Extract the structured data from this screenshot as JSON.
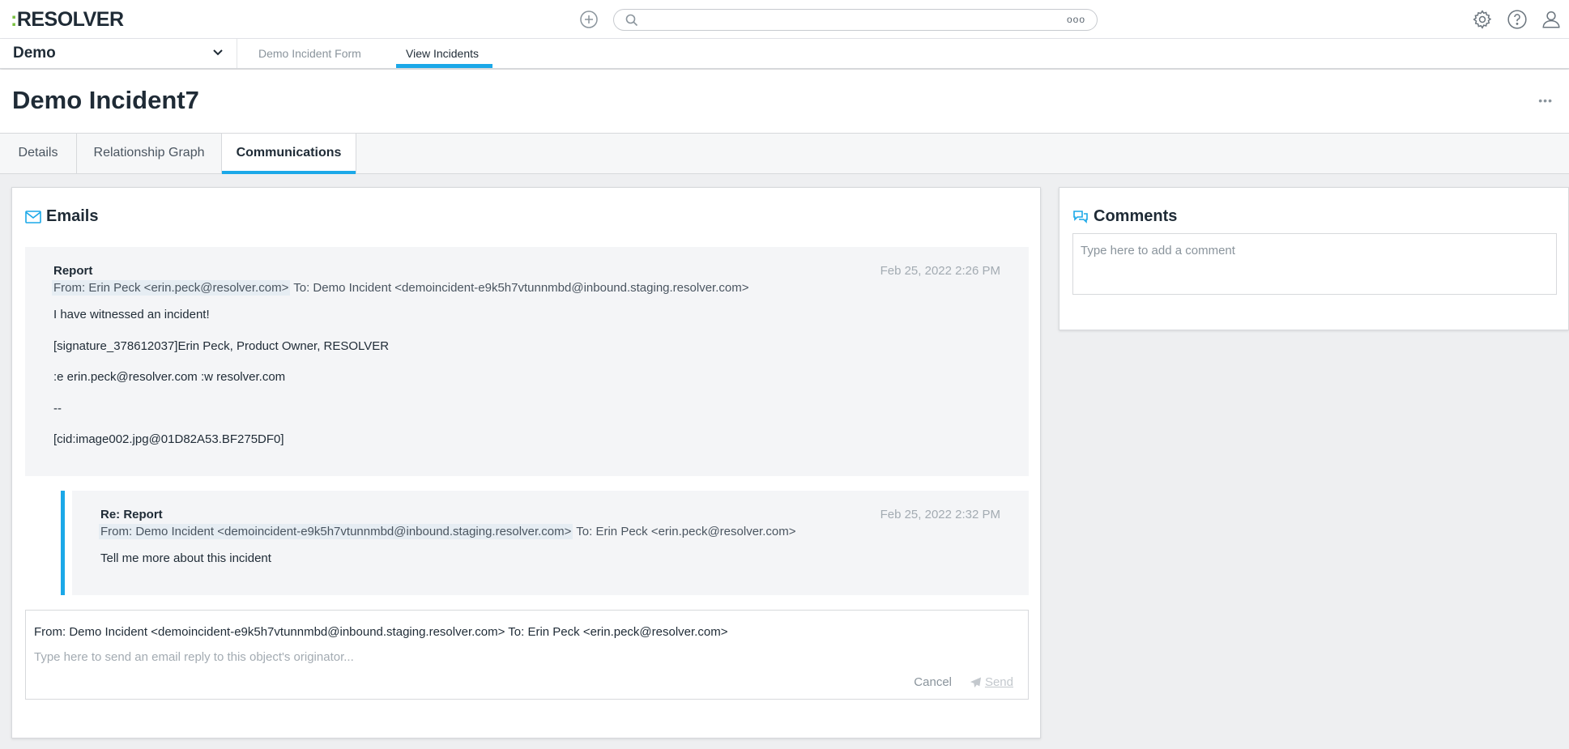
{
  "header": {
    "logo_colon": ":",
    "logo_text": "RESOLVER",
    "search_more": "ooo"
  },
  "nav": {
    "app_name": "Demo",
    "tabs": [
      {
        "label": "Demo Incident Form"
      },
      {
        "label": "View Incidents"
      }
    ]
  },
  "page": {
    "title": "Demo Incident7",
    "more": "•••"
  },
  "tabs": [
    {
      "label": "Details"
    },
    {
      "label": "Relationship Graph"
    },
    {
      "label": "Communications"
    }
  ],
  "emails": {
    "title": "Emails",
    "items": [
      {
        "subject": "Report",
        "date": "Feb 25, 2022 2:26 PM",
        "from": "From: Erin Peck <erin.peck@resolver.com>",
        "to": "To: Demo Incident <demoincident-e9k5h7vtunnmbd@inbound.staging.resolver.com>",
        "body": [
          "I have witnessed an incident!",
          "[signature_378612037]Erin Peck, Product Owner, RESOLVER",
          ":e erin.peck@resolver.com :w resolver.com",
          "--",
          "[cid:image002.jpg@01D82A53.BF275DF0]"
        ]
      },
      {
        "subject": "Re: Report",
        "date": "Feb 25, 2022 2:32 PM",
        "from": "From: Demo Incident <demoincident-e9k5h7vtunnmbd@inbound.staging.resolver.com>",
        "to": "To: Erin Peck <erin.peck@resolver.com>",
        "body": [
          "Tell me more about this incident"
        ]
      }
    ],
    "compose": {
      "addresses": "From: Demo Incident <demoincident-e9k5h7vtunnmbd@inbound.staging.resolver.com>  To: Erin Peck <erin.peck@resolver.com>",
      "placeholder": "Type here to send an email reply to this object's originator...",
      "cancel_label": "Cancel",
      "send_label": "Send"
    }
  },
  "comments": {
    "title": "Comments",
    "placeholder": "Type here to add a comment"
  },
  "icons": {
    "add": "plus-circle-icon",
    "search": "search-icon",
    "settings": "gear-icon",
    "help": "help-circle-icon",
    "user": "user-icon",
    "dropdown": "chevron-down-icon",
    "emails": "envelope-icon",
    "comments": "chat-bubbles-icon",
    "send": "paper-plane-icon"
  },
  "colors": {
    "accent": "#1ba8e8",
    "logo_colon": "#7ac142",
    "text": "#1f2b36",
    "muted": "#a3abb2"
  }
}
